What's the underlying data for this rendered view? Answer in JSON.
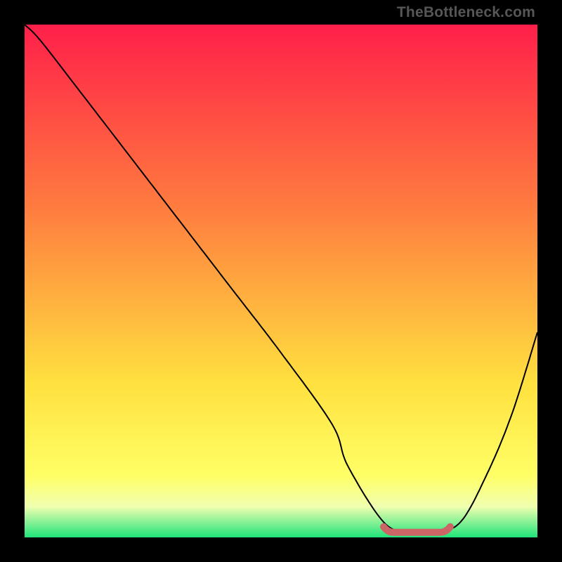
{
  "watermark": "TheBottleneck.com",
  "colors": {
    "top": "#ff1f4a",
    "mid_upper": "#ff7a3f",
    "mid": "#ffe13f",
    "band_yellow": "#ffff66",
    "band_pale": "#f0ffb0",
    "bottom": "#1fe47a",
    "curve": "#000000",
    "marker": "#cc6666"
  },
  "chart_data": {
    "type": "line",
    "title": "",
    "xlabel": "",
    "ylabel": "",
    "xlim": [
      0,
      100
    ],
    "ylim": [
      0,
      100
    ],
    "x": [
      0,
      3,
      10,
      20,
      30,
      40,
      50,
      60,
      63,
      70,
      75,
      80,
      85,
      90,
      95,
      100
    ],
    "values": [
      100,
      97,
      88,
      75,
      62,
      49,
      36,
      22,
      14,
      3,
      1,
      1,
      3,
      12,
      24,
      40
    ],
    "optimal_range_x": [
      70,
      83
    ],
    "optimal_y": 1
  }
}
